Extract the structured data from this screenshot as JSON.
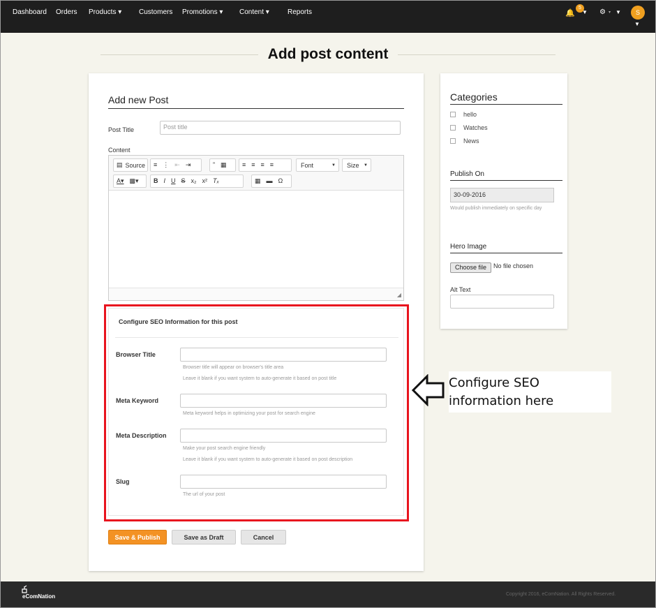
{
  "nav": {
    "items": [
      {
        "label": "Dashboard"
      },
      {
        "label": "Orders"
      },
      {
        "label": "Products ▾"
      },
      {
        "label": "Customers"
      },
      {
        "label": "Promotions ▾"
      },
      {
        "label": "Content ▾"
      },
      {
        "label": "Reports"
      }
    ],
    "notification_count": "5",
    "avatar_initial": "S",
    "caret": "▼"
  },
  "page": {
    "title": "Add post content"
  },
  "form": {
    "heading": "Add new Post",
    "post_title_label": "Post Title",
    "post_title_placeholder": "Post title",
    "content_label": "Content",
    "editor": {
      "source_label": "Source",
      "font_label": "Font",
      "size_label": "Size"
    },
    "seo": {
      "title": "Configure SEO Information for this post",
      "browser_title_label": "Browser Title",
      "browser_title_help1": "Browser title will appear on browser's title area",
      "browser_title_help2": "Leave it blank if you want system to auto-generate it based on post title",
      "meta_keyword_label": "Meta Keyword",
      "meta_keyword_help": "Meta keyword helps in optimizing your post for search engine",
      "meta_description_label": "Meta Description",
      "meta_description_help1": "Make your post search engine friendly",
      "meta_description_help2": "Leave it blank if you want system to auto-generate it based on post description",
      "slug_label": "Slug",
      "slug_help": "The url of your post"
    },
    "buttons": {
      "save_publish": "Save & Publish",
      "save_draft": "Save as Draft",
      "cancel": "Cancel"
    }
  },
  "sidebar": {
    "categories_heading": "Categories",
    "categories": [
      {
        "label": "hello"
      },
      {
        "label": "Watches"
      },
      {
        "label": "News"
      }
    ],
    "publish_on_heading": "Publish On",
    "publish_date": "30-09-2016",
    "publish_help": "Would publish immediately on specific day",
    "hero_image_heading": "Hero Image",
    "choose_file_label": "Choose file",
    "no_file_text": "No file chosen",
    "alt_text_label": "Alt Text"
  },
  "callout": {
    "line1": "Configure SEO",
    "line2": "information here"
  },
  "footer": {
    "brand": "eComNation",
    "copyright": "Copyright 2016, eComNation. All Rights Reserved."
  }
}
